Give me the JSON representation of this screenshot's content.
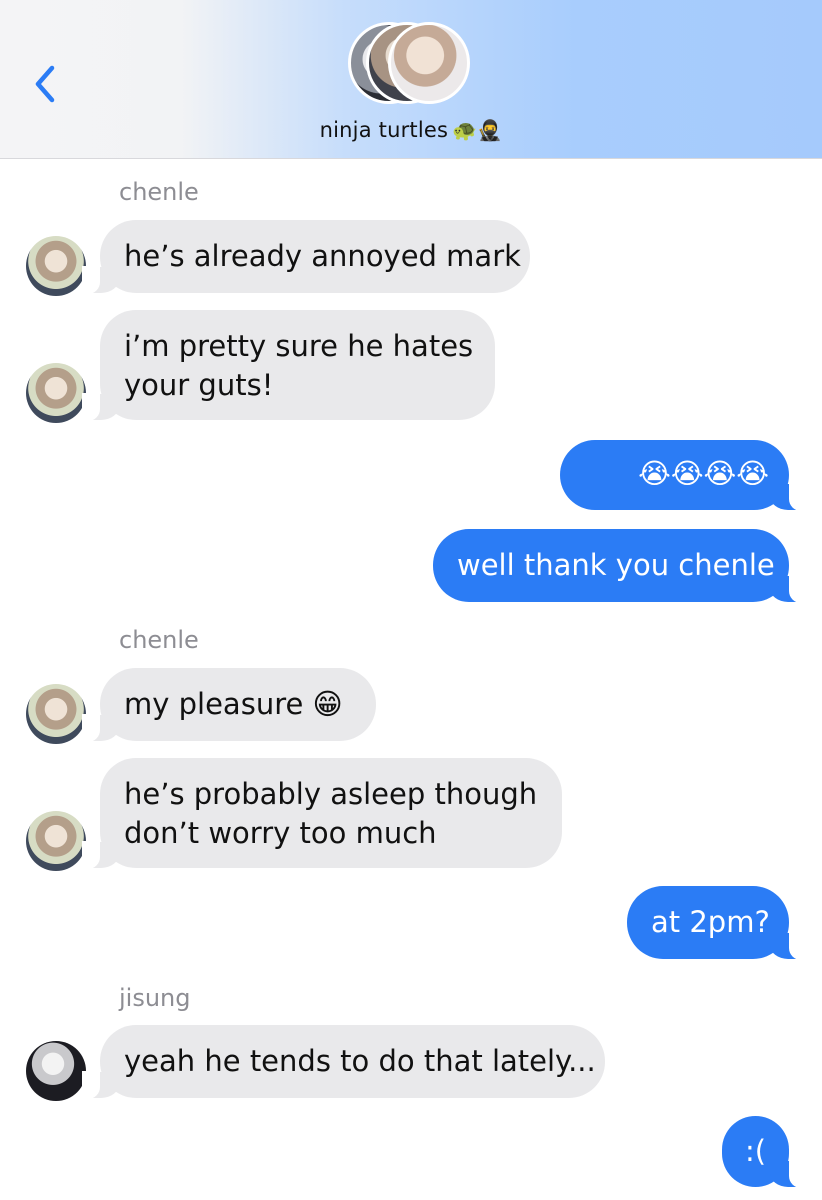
{
  "header": {
    "group_name": "ninja turtles",
    "group_emoji": "🐢🥷"
  },
  "messages": [
    {
      "type": "sender",
      "text": "chenle"
    },
    {
      "type": "in",
      "text": "he’s already annoyed mark"
    },
    {
      "type": "in",
      "lines": [
        "i’m pretty sure he hates",
        "your guts!"
      ]
    },
    {
      "type": "out",
      "text": "😭😭😭😭"
    },
    {
      "type": "out",
      "text": "well thank you chenle"
    },
    {
      "type": "sender",
      "text": "chenle"
    },
    {
      "type": "in",
      "text": "my pleasure 😁"
    },
    {
      "type": "in",
      "lines": [
        "he’s probably asleep though",
        "don’t worry too much"
      ]
    },
    {
      "type": "out",
      "text": "at 2pm?"
    },
    {
      "type": "sender",
      "text": "jisung"
    },
    {
      "type": "in",
      "text": "yeah he tends to do that lately..."
    },
    {
      "type": "out",
      "text": ":("
    }
  ],
  "colors": {
    "outgoing_bubble": "#2b7cf5",
    "incoming_bubble": "#e9e9eb",
    "back_chevron": "#2b7cf5"
  },
  "icons": [
    "back-chevron-icon"
  ]
}
